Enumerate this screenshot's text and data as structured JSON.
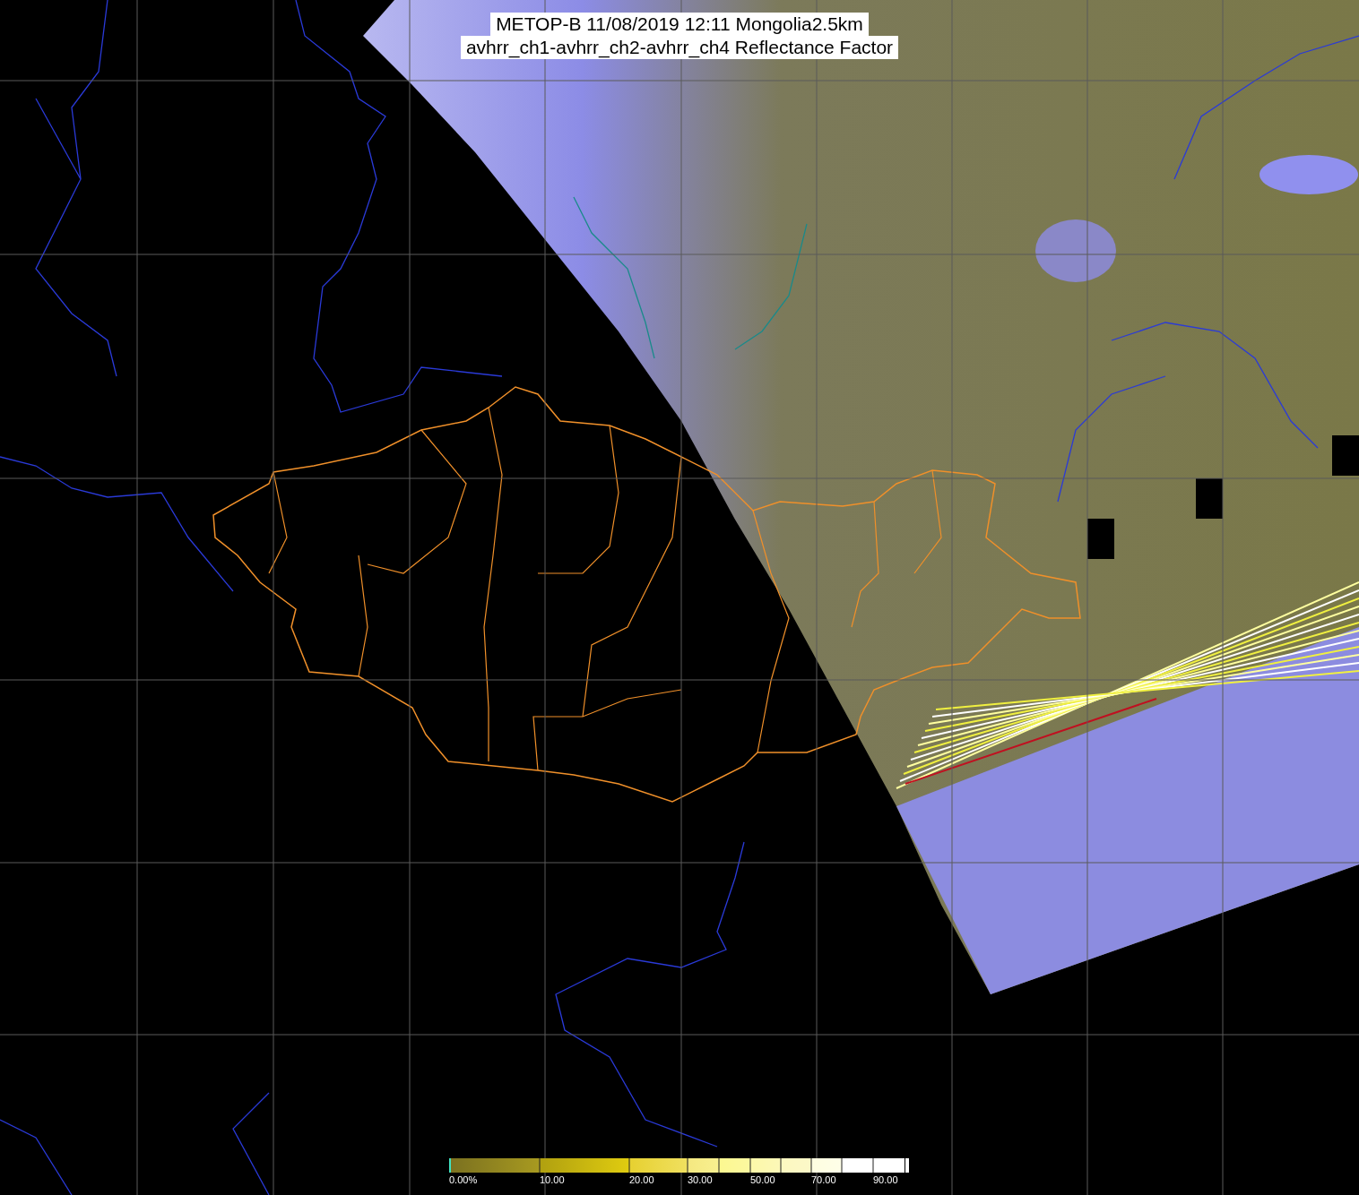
{
  "title": {
    "line_1": "METOP-B 11/08/2019 12:11 Mongolia2.5km",
    "line_2": "avhrr_ch1-avhrr_ch2-avhrr_ch4 Reflectance Factor"
  },
  "colorbar": {
    "labels": [
      "0.00%",
      "10.00",
      "20.00",
      "30.00",
      "50.00",
      "70.00",
      "90.00"
    ]
  }
}
